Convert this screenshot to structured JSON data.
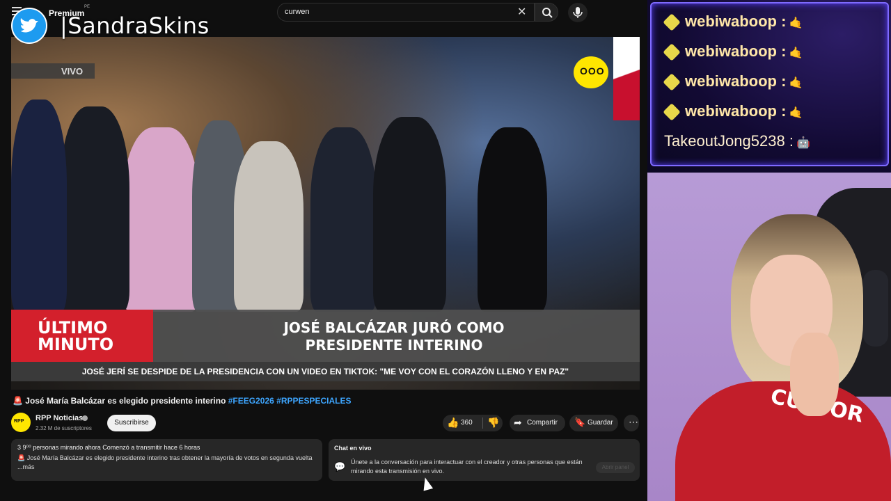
{
  "youtube": {
    "premium_label": "Premium",
    "premium_country": "PE",
    "search_value": "curwen",
    "video": {
      "live_label": "VIVO",
      "channel_logo_text": "OOO",
      "breaking_label": "ÚLTIMO MINUTO",
      "headline_line1": "JOSÉ BALCÁZAR JURÓ COMO",
      "headline_line2": "PRESIDENTE INTERINO",
      "ticker": "JOSÉ JERÍ SE DESPIDE DE LA PRESIDENCIA CON UN VIDEO EN TIKTOK: \"ME VOY CON EL CORAZÓN LLENO Y EN PAZ\""
    },
    "title_main": "José María Balcázar es elegido presidente interino ",
    "title_tag1": "#FEEG2026",
    "title_tag2": "#RPPESPECIALES",
    "channel": {
      "name": "RPP Noticias",
      "subscribers": "2.32 M de suscriptores",
      "avatar_text": "RPP",
      "subscribe_label": "Suscribirse"
    },
    "actions": {
      "likes": "360",
      "share": "Compartir",
      "save": "Guardar"
    },
    "description": {
      "viewers_line": "3 9⁰⁰ personas mirando ahora  Comenzó a transmitir hace 6 horas",
      "body": "José María Balcázar es elegido presidente interino tras obtener la mayoría de votos en segunda vuelta   ...más"
    },
    "live_chat": {
      "title": "Chat en vivo",
      "body": "Únete a la conversación para interactuar con el creador y otras personas que están mirando esta transmisión en vivo.",
      "open_button": "Abrir panel"
    }
  },
  "overlay": {
    "twitter_handle": "SandraSkins",
    "chat_messages": [
      {
        "user": "webiwaboop :",
        "emote": "🤙"
      },
      {
        "user": "webiwaboop :",
        "emote": "🤙"
      },
      {
        "user": "webiwaboop :",
        "emote": "🤙"
      },
      {
        "user": "webiwaboop :",
        "emote": "🤙"
      },
      {
        "user": "TakeoutJong5238 :",
        "emote": "🤖"
      }
    ]
  },
  "webcam": {
    "shirt_text": "CUATOR"
  }
}
